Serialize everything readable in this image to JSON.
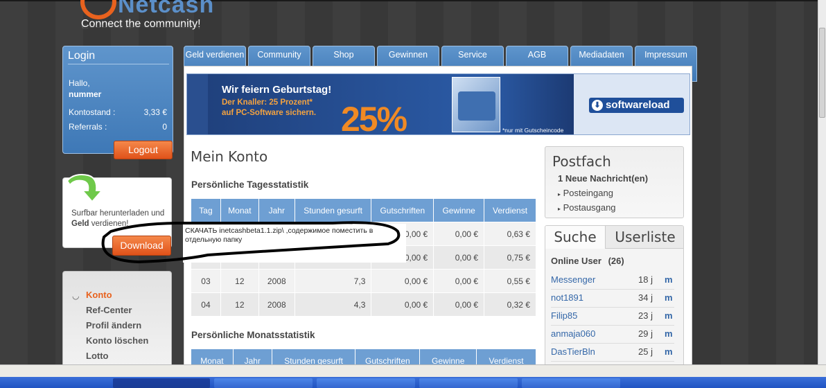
{
  "logo": {
    "brand": "Netcash",
    "tagline": "Connect the community!"
  },
  "login": {
    "title": "Login",
    "greeting": "Hallo,",
    "username": "nummer",
    "balance_label": "Kontostand :",
    "balance_value": "3,33 €",
    "referrals_label": "Referrals :",
    "referrals_value": "0",
    "logout_label": "Logout"
  },
  "surfbar": {
    "text_before": "Surfbar herunterladen und",
    "text_bold": "Geld",
    "text_after": "verdienen!",
    "download_label": "Download"
  },
  "nav": {
    "items": [
      {
        "label": "Konto"
      },
      {
        "label": "Ref-Center"
      },
      {
        "label": "Profil ändern"
      },
      {
        "label": "Konto löschen"
      },
      {
        "label": "Lotto"
      }
    ]
  },
  "tabs": [
    {
      "label": "Geld verdienen"
    },
    {
      "label": "Community"
    },
    {
      "label": "Shop"
    },
    {
      "label": "Gewinnen"
    },
    {
      "label": "Service"
    },
    {
      "label": "AGB"
    },
    {
      "label": "Mediadaten"
    },
    {
      "label": "Impressum"
    }
  ],
  "banner": {
    "title": "Wir feiern Geburtstag!",
    "line1": "Der Knaller: 25 Prozent*",
    "line2": "auf PC-Software sichern.",
    "percent": "25%",
    "note": "*nur mit Gutscheincode",
    "logo": "softwareload"
  },
  "main": {
    "title": "Mein Konto",
    "daily_title": "Persönliche Tagesstatistik",
    "daily_headers": [
      "Tag",
      "Monat",
      "Jahr",
      "Stunden gesurft",
      "Gutschriften",
      "Gewinne",
      "Verdienst"
    ],
    "daily_rows": [
      {
        "tag": "",
        "monat": "",
        "jahr": "",
        "stunden": "",
        "gutschriften": "0,00 €",
        "gewinne": "0,00 €",
        "verdienst": "0,63 €"
      },
      {
        "tag": "",
        "monat": "",
        "jahr": "",
        "stunden": "",
        "gutschriften": "0,00 €",
        "gewinne": "0,00 €",
        "verdienst": "0,75 €"
      },
      {
        "tag": "03",
        "monat": "12",
        "jahr": "2008",
        "stunden": "7,3",
        "gutschriften": "0,00 €",
        "gewinne": "0,00 €",
        "verdienst": "0,55 €"
      },
      {
        "tag": "04",
        "monat": "12",
        "jahr": "2008",
        "stunden": "4,3",
        "gutschriften": "0,00 €",
        "gewinne": "0,00 €",
        "verdienst": "0,32 €"
      }
    ],
    "monthly_title": "Persönliche Monatsstatistik",
    "monthly_headers": [
      "Monat",
      "Jahr",
      "Stunden gesurft",
      "Gutschriften",
      "Gewinne",
      "Verdienst"
    ]
  },
  "postfach": {
    "title": "Postfach",
    "new_messages": "1 Neue Nachricht(en)",
    "inbox": "Posteingang",
    "outbox": "Postausgang"
  },
  "users": {
    "tab_search": "Suche",
    "tab_list": "Userliste",
    "online_label": "Online User",
    "online_count": "(26)",
    "list": [
      {
        "name": "Messenger",
        "age": "18 j",
        "m": "m"
      },
      {
        "name": "not1891",
        "age": "34 j",
        "m": "m"
      },
      {
        "name": "Filip85",
        "age": "23 j",
        "m": "m"
      },
      {
        "name": "anmaja060",
        "age": "29 j",
        "m": "m"
      },
      {
        "name": "DasTierBln",
        "age": "25 j",
        "m": "m"
      }
    ]
  },
  "annotation": {
    "text": "СКАЧАТЬ inetcashbeta1.1.zip\\ ,содержимое поместить в отдельную папку"
  },
  "colors": {
    "accent_orange": "#e8621e",
    "tab_blue": "#4a84c1",
    "table_header_blue": "#6e9fd3",
    "link_blue": "#3467a8"
  }
}
